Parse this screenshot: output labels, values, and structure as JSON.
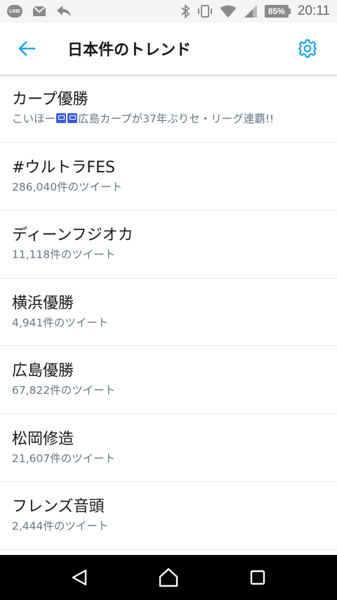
{
  "status_bar": {
    "line_label": "LINE",
    "battery": "85%",
    "time": "20:11"
  },
  "header": {
    "title": "日本件のトレンド",
    "accent_color": "#1da1f2"
  },
  "trends": [
    {
      "name": "カープ優勝",
      "meta_before": "こいほー",
      "meta_after": "広島カープが37年ぶりセ・リーグ連覇!!"
    },
    {
      "name": "#ウルトラFES",
      "meta": "286,040件のツイート"
    },
    {
      "name": "ディーンフジオカ",
      "meta": "11,118件のツイート"
    },
    {
      "name": "横浜優勝",
      "meta": "4,941件のツイート"
    },
    {
      "name": "広島優勝",
      "meta": "67,822件のツイート"
    },
    {
      "name": "松岡修造",
      "meta": "21,607件のツイート"
    },
    {
      "name": "フレンズ音頭",
      "meta": "2,444件のツイート"
    }
  ]
}
